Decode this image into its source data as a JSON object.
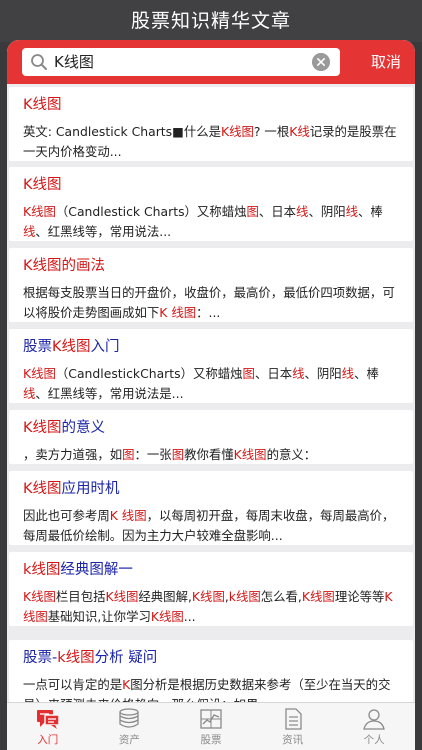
{
  "window": {
    "title": "股票知识精华文章"
  },
  "search": {
    "value": "K线图",
    "cancel_label": "取消"
  },
  "results": [
    {
      "title": [
        {
          "t": "K线图",
          "h": true
        }
      ],
      "body": [
        {
          "t": "英文: Candlestick Charts■什么是",
          "h": false
        },
        {
          "t": "K线图",
          "h": true
        },
        {
          "t": "? 一根",
          "h": false
        },
        {
          "t": "K线",
          "h": true
        },
        {
          "t": "记录的是股票在一天内价格变动...",
          "h": false
        }
      ]
    },
    {
      "title": [
        {
          "t": "K线图",
          "h": true
        }
      ],
      "body": [
        {
          "t": "K线图",
          "h": true
        },
        {
          "t": "（Candlestick Charts）又称蜡烛",
          "h": false
        },
        {
          "t": "图",
          "h": true
        },
        {
          "t": "、日本",
          "h": false
        },
        {
          "t": "线",
          "h": true
        },
        {
          "t": "、阴阳",
          "h": false
        },
        {
          "t": "线",
          "h": true
        },
        {
          "t": "、棒",
          "h": false
        },
        {
          "t": "线",
          "h": true
        },
        {
          "t": "、红黑线等，常用说法...",
          "h": false
        }
      ]
    },
    {
      "title": [
        {
          "t": "K线图的画法",
          "h": true
        }
      ],
      "body": [
        {
          "t": "根据每支股票当日的开盘价，收盘价，最高价，最低价四项数据，可以将股价走势图画成如下",
          "h": false
        },
        {
          "t": "K 线图",
          "h": true
        },
        {
          "t": "：...",
          "h": false
        }
      ]
    },
    {
      "title": [
        {
          "t": "股票",
          "h": false
        },
        {
          "t": "K线图",
          "h": true
        },
        {
          "t": "入门",
          "h": false
        }
      ],
      "body": [
        {
          "t": "K线图",
          "h": true
        },
        {
          "t": "（CandlestickCharts）又称蜡烛",
          "h": false
        },
        {
          "t": "图",
          "h": true
        },
        {
          "t": "、日本",
          "h": false
        },
        {
          "t": "线",
          "h": true
        },
        {
          "t": "、阴阳",
          "h": false
        },
        {
          "t": "线",
          "h": true
        },
        {
          "t": "、棒",
          "h": false
        },
        {
          "t": "线",
          "h": true
        },
        {
          "t": "、红黑线等，常用说法是...",
          "h": false
        }
      ]
    },
    {
      "title": [
        {
          "t": "K线图",
          "h": true
        },
        {
          "t": "的意义",
          "h": false
        }
      ],
      "body": [
        {
          "t": "，卖方力道强，如",
          "h": false
        },
        {
          "t": "图",
          "h": true
        },
        {
          "t": "：一张",
          "h": false
        },
        {
          "t": "图",
          "h": true
        },
        {
          "t": "教你看懂",
          "h": false
        },
        {
          "t": "K线图",
          "h": true
        },
        {
          "t": "的意义：",
          "h": false
        }
      ]
    },
    {
      "title": [
        {
          "t": "K线图",
          "h": true
        },
        {
          "t": "应用时机",
          "h": false
        }
      ],
      "body": [
        {
          "t": "因此也可参考周",
          "h": false
        },
        {
          "t": "K 线图",
          "h": true
        },
        {
          "t": "，以每周初开盘，每周末收盘，每周最高价，每周最低价绘制。因为主力大户较难全盘影响...",
          "h": false
        }
      ]
    },
    {
      "title": [
        {
          "t": "k线图",
          "h": true
        },
        {
          "t": "经典图解一",
          "h": false
        }
      ],
      "body": [
        {
          "t": "K线图",
          "h": true
        },
        {
          "t": "栏目包括",
          "h": false
        },
        {
          "t": "K线图",
          "h": true
        },
        {
          "t": "经典图解,",
          "h": false
        },
        {
          "t": "K线图",
          "h": true
        },
        {
          "t": ",",
          "h": false
        },
        {
          "t": "k线图",
          "h": true
        },
        {
          "t": "怎么看,",
          "h": false
        },
        {
          "t": "K线图",
          "h": true
        },
        {
          "t": "理论等等",
          "h": false
        },
        {
          "t": "K线图",
          "h": true
        },
        {
          "t": "基础知识,让你学习",
          "h": false
        },
        {
          "t": "K线图",
          "h": true
        },
        {
          "t": "...",
          "h": false
        }
      ]
    },
    {
      "title": [
        {
          "t": "股票-",
          "h": false
        },
        {
          "t": "k线图",
          "h": true
        },
        {
          "t": "分析 疑问",
          "h": false
        }
      ],
      "body": [
        {
          "t": "一点可以肯定的是",
          "h": false
        },
        {
          "t": "K",
          "h": true
        },
        {
          "t": "图分析是根据历史数据来参考（至少在当天的交易）来预测未来价格趋向。那么假设：如果...",
          "h": false
        }
      ]
    }
  ],
  "tabs": [
    {
      "label": "入门",
      "icon": "chat-bubbles-icon",
      "active": true
    },
    {
      "label": "资产",
      "icon": "coin-stack-icon",
      "active": false
    },
    {
      "label": "股票",
      "icon": "chart-frame-icon",
      "active": false
    },
    {
      "label": "资讯",
      "icon": "document-icon",
      "active": false
    },
    {
      "label": "个人",
      "icon": "person-icon",
      "active": false
    }
  ],
  "colors": {
    "accent": "#e53434",
    "highlight": "#d31515",
    "title_blue": "#1b24a8"
  }
}
